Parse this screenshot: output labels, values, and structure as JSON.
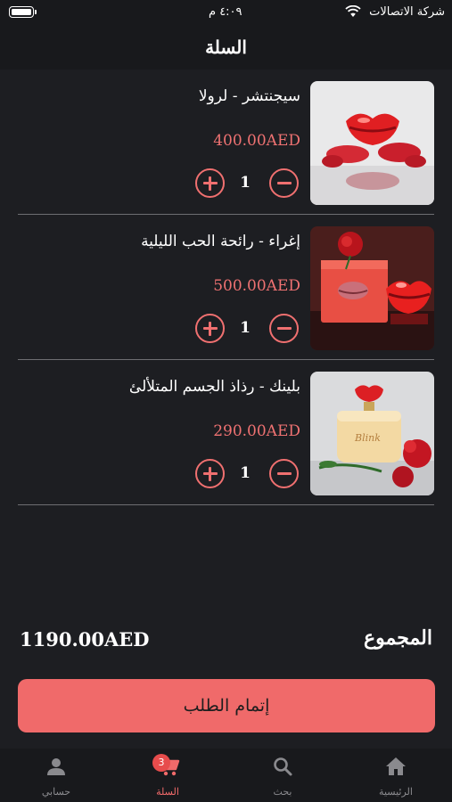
{
  "status_bar": {
    "carrier": "شركة الاتصالات",
    "time": "٤:٠٩ م"
  },
  "header": {
    "title": "السلة"
  },
  "cart": {
    "items": [
      {
        "name": "سيجنتشر - لرولا",
        "price": "400.00AED",
        "quantity": "1"
      },
      {
        "name": "إغراء - رائحة الحب الليلية",
        "price": "500.00AED",
        "quantity": "1"
      },
      {
        "name": "بلينك - رذاذ الجسم المتلألئ",
        "price": "290.00AED",
        "quantity": "1"
      }
    ]
  },
  "summary": {
    "total_label": "المجموع",
    "total_value": "1190.00AED"
  },
  "checkout": {
    "label": "إتمام الطلب"
  },
  "tab_bar": {
    "tabs": [
      {
        "label": "الرئيسية",
        "icon": "home-icon"
      },
      {
        "label": "بحث",
        "icon": "search-icon"
      },
      {
        "label": "السلة",
        "icon": "cart-icon",
        "badge": "3",
        "active": true
      },
      {
        "label": "حسابي",
        "icon": "person-icon"
      }
    ]
  },
  "colors": {
    "background": "#1d1e22",
    "accent": "#f06a6a",
    "price": "#ef7272",
    "divider": "#6e6e72"
  }
}
